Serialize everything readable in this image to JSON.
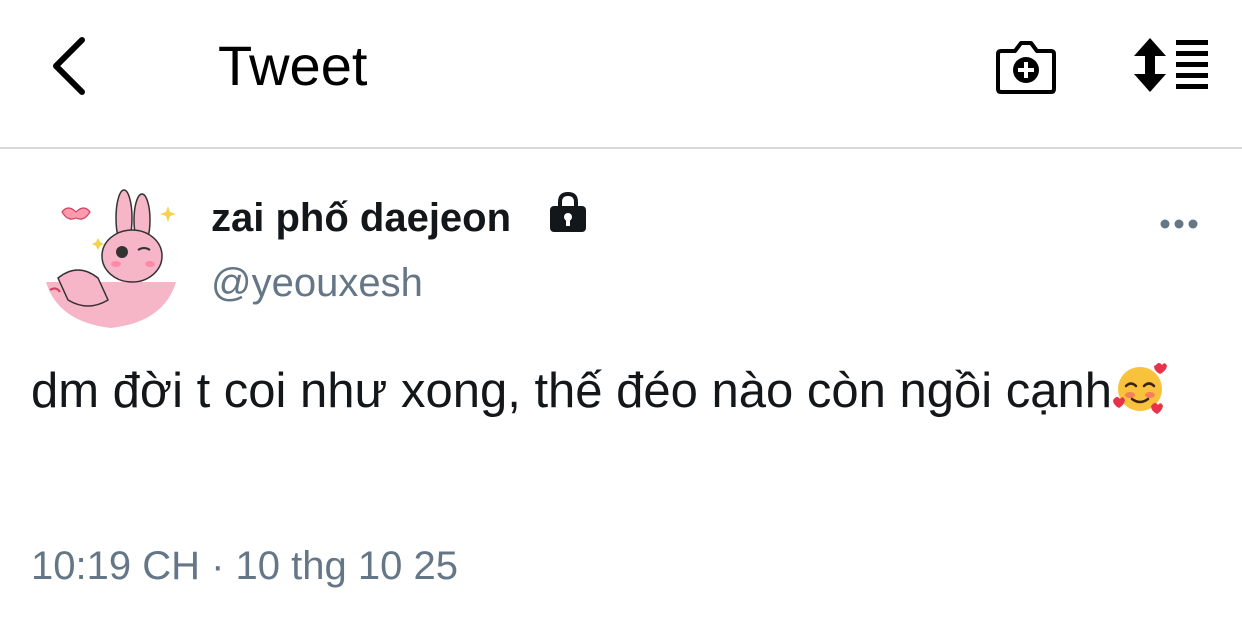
{
  "header": {
    "title": "Tweet",
    "back_icon": "chevron-left-icon",
    "camera_icon": "camera-plus-icon",
    "sort_icon": "sort-list-icon"
  },
  "tweet": {
    "display_name": "zai phố daejeon",
    "handle": "@yeouxesh",
    "protected_icon": "lock-icon",
    "avatar_icon": "pink-bunny-avatar",
    "more_icon": "more-dots-icon",
    "text": "dm đời t coi như xong, thế đéo nào còn ngồi cạnh",
    "emoji": "smiling-face-with-hearts",
    "timestamp": "10:19 CH · 10 thg 10 25"
  },
  "colors": {
    "text_primary": "#14171a",
    "text_secondary": "#657786",
    "divider": "#d4d7da",
    "avatar_pink": "#f7b6c8"
  }
}
